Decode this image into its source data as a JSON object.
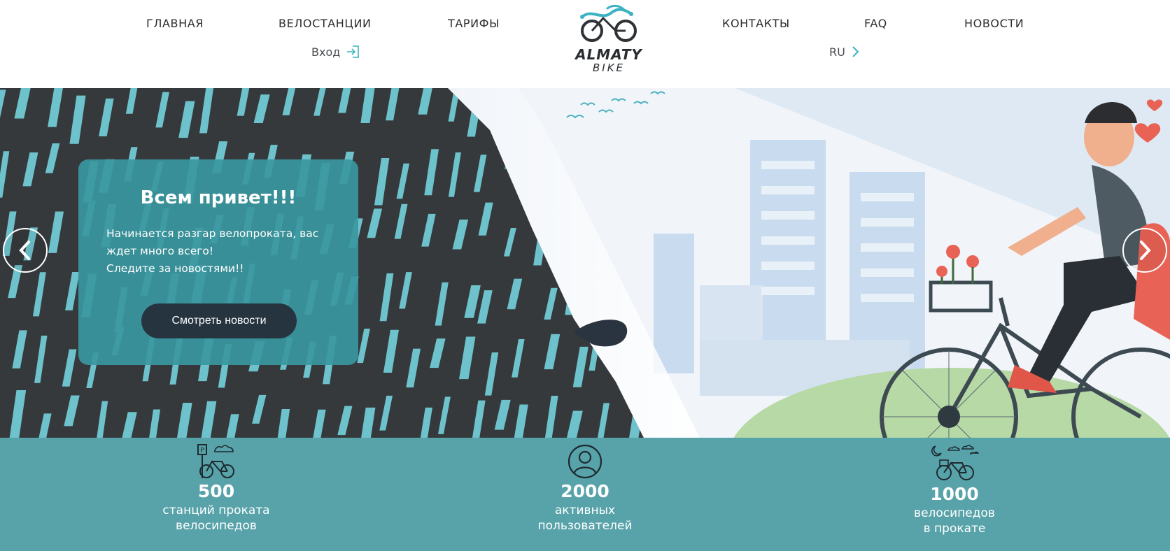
{
  "nav": {
    "left": [
      "ГЛАВНАЯ",
      "ВЕЛОСТАНЦИИ",
      "ТАРИФЫ"
    ],
    "right": [
      "КОНТАКТЫ",
      "FAQ",
      "НОВОСТИ"
    ],
    "login_label": "Вход",
    "language": "RU"
  },
  "logo": {
    "name": "ALMATY",
    "sub": "BIKE"
  },
  "hero": {
    "title": "Всем привет!!!",
    "text_lines": [
      "Начинается разгар велопроката, вас",
      "ждет много всего!",
      "Следите за новостями!!"
    ],
    "button_label": "Смотреть новости"
  },
  "stats": [
    {
      "value": "500",
      "label_lines": [
        "станций проката",
        "велосипедов"
      ],
      "icon": "bike-station-icon"
    },
    {
      "value": "2000",
      "label_lines": [
        "активных",
        "пользователей"
      ],
      "icon": "user-icon"
    },
    {
      "value": "1000",
      "label_lines": [
        "велосипедов",
        "в прокате"
      ],
      "icon": "bicycle-weather-icon"
    }
  ],
  "colors": {
    "accent": "#3a97a0",
    "stats_bg": "#58a3aa",
    "button_dark": "#263440",
    "logo_teal": "#3bb3c3"
  }
}
